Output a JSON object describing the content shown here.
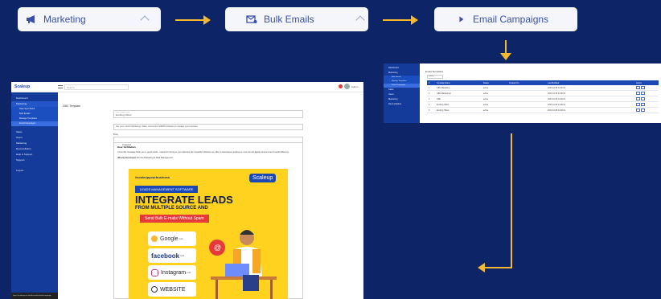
{
  "flow": {
    "step1": {
      "label": "Marketing",
      "icon": "megaphone-icon"
    },
    "step2": {
      "label": "Bulk Emails",
      "icon": "mail-icon"
    },
    "step3": {
      "label": "Email Campaigns",
      "icon": "play-icon"
    }
  },
  "colors": {
    "background": "#0d2566",
    "arrow": "#f5b82e",
    "pill": "#f4f6fb",
    "pill_text": "#3a4fa8",
    "sidebar": "#143a9a"
  },
  "editor_shot": {
    "brand": "Scaleup",
    "search_placeholder": "Search",
    "user_name": "Admin",
    "page_title": "GBC Template",
    "sidebar_items": [
      "Dashboard",
      "Marketing",
      "Sales",
      "Users",
      "Marketing",
      "Reconciliation",
      "Help & Support",
      "Support",
      "Logout"
    ],
    "sidebar_subitems": [
      "Data Sync Batch",
      "Bulk Emails",
      "Manage Templates",
      "Email Campaigns"
    ],
    "subject_label": "Sub. Subject Line",
    "subject_value": "Exciting Offers",
    "preview_text": "Get your current Marketing, Sales, Accounts & HRMS software to manage your business.",
    "body_label": "Body",
    "format_label": "Paragraph",
    "greeting": "Dear Sir/Madam",
    "body_text": "I trust this message finds you in good spirits. I wanted to bring to your attention the impactful solutions we offer to businesses seeking a more formal digital presence and overall efficiency.",
    "signoff": "(Mostly Developer)",
    "signoff_tail": "All-One Marketing & Data Management",
    "status_url": "https://scaleupcrm.in/bulk-emails/email-campaign"
  },
  "poster": {
    "top_left": "#scaleupyourbusiness",
    "brand": "Scaleup",
    "ribbon": "LEADS MANAGEMENT SOFTWARE",
    "headline": "INTEGRATE LEADS",
    "subheadline": "FROM MULTIPLE SOURCE AND",
    "banner": "Send Bulk E-mails Without Spam",
    "logos": [
      {
        "name": "Google",
        "sub": "Ads"
      },
      {
        "name": "facebook",
        "sub": "Ads"
      },
      {
        "name": "Instagram",
        "sub": "Ads"
      },
      {
        "name": "WEBSITE",
        "sub": ""
      }
    ]
  },
  "campaign_shot": {
    "title": "Email Templates",
    "search_label": "Search",
    "sidebar_items": [
      "Dashboard",
      "Marketing",
      "Sales",
      "Users",
      "Marketing",
      "Reconciliation"
    ],
    "sidebar_subitems": [
      "Bulk Emails",
      "Manage Templates",
      "Email Campaigns"
    ],
    "columns": [
      "#",
      "Template Name",
      "Status",
      "Created On",
      "Last Modified",
      "Action"
    ],
    "rows": [
      [
        "1",
        "GBC Marketing",
        "active",
        "",
        "2023-10-05 14:00:02",
        ""
      ],
      [
        "2",
        "GBC Marketing2",
        "active",
        "",
        "2023-10-05 14:00:03",
        ""
      ],
      [
        "3",
        "GBC",
        "active",
        "",
        "2023-10-05 14:00:01",
        ""
      ],
      [
        "4",
        "Exciting Offers",
        "active",
        "",
        "2023-10-05 14:00:01",
        ""
      ],
      [
        "5",
        "Exciting Offers",
        "active",
        "",
        "2023-10-05 14:00:01",
        ""
      ]
    ]
  }
}
